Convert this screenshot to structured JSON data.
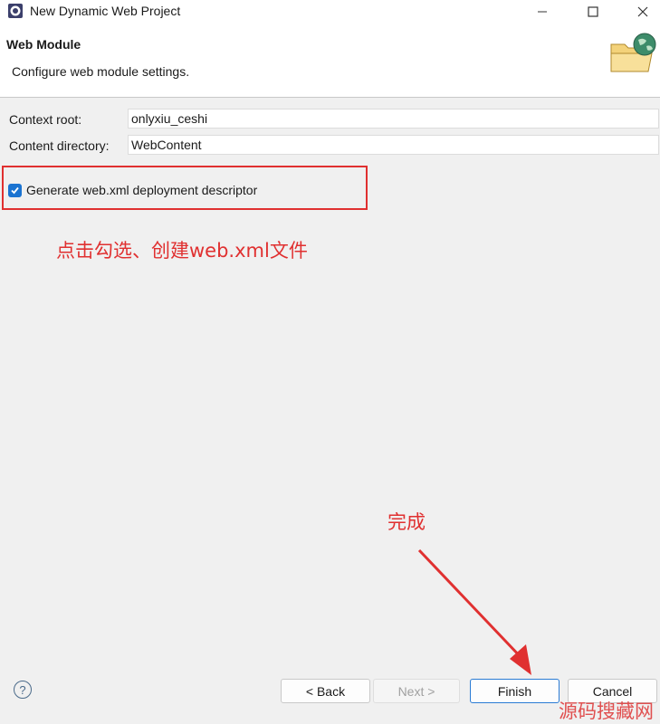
{
  "window": {
    "title": "New Dynamic Web Project"
  },
  "header": {
    "title": "Web Module",
    "description": "Configure web module settings."
  },
  "form": {
    "context_root": {
      "label": "Context root:",
      "value": "onlyxiu_ceshi"
    },
    "content_directory": {
      "label": "Content directory:",
      "value": "WebContent"
    },
    "generate_descriptor": {
      "label": "Generate web.xml deployment descriptor",
      "checked": true
    }
  },
  "annotations": {
    "checkbox_note": "点击勾选、创建web.xml文件",
    "finish_note": "完成"
  },
  "buttons": {
    "back": "< Back",
    "next": "Next >",
    "finish": "Finish",
    "cancel": "Cancel"
  },
  "watermark": "源码搜藏网",
  "colors": {
    "annotation": "#e03030",
    "checkbox": "#1a73d1",
    "primary_border": "#2a7bd4"
  },
  "icons": [
    "eclipse-app-icon",
    "minimize-icon",
    "maximize-icon",
    "close-icon",
    "web-folder-globe-icon",
    "help-icon",
    "checkmark-icon"
  ]
}
